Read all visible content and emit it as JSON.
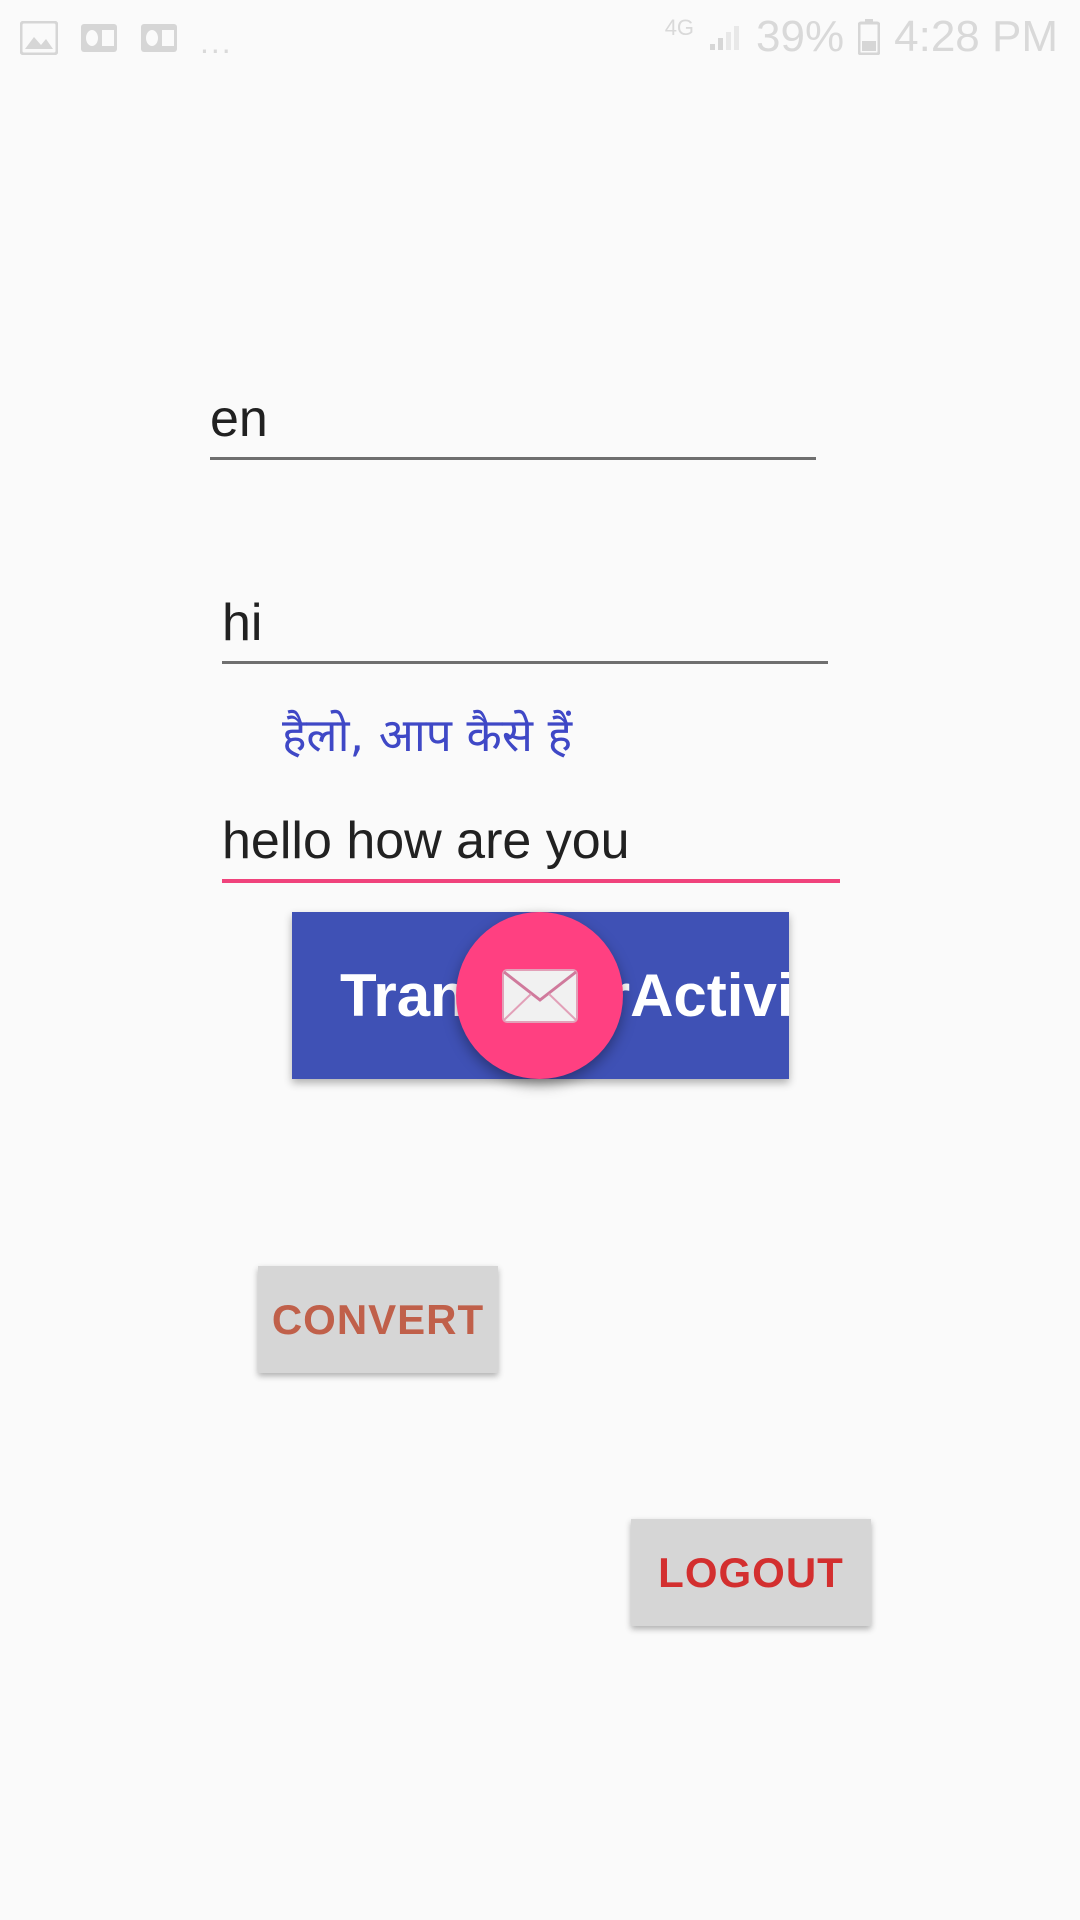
{
  "status_bar": {
    "left_icons": [
      "image-icon",
      "outlook-icon",
      "outlook-icon"
    ],
    "more": "...",
    "signal_text": "4G",
    "battery_percent": "39%",
    "time": "4:28 PM"
  },
  "form": {
    "source_language": "en",
    "target_language": "hi",
    "translated_text": "हैलो, आप कैसे हैं",
    "input_text": "hello how are you"
  },
  "buttons": {
    "activity_label": "TranslatorActivity",
    "convert_label": "CONVERT",
    "logout_label": "LOGOUT"
  },
  "fab": {
    "icon": "envelope-icon"
  },
  "colors": {
    "background": "#fafafa",
    "primary": "#3f51b5",
    "accent": "#ff4081",
    "translated_text": "#3f48c6",
    "convert_text": "#c0604a",
    "logout_text": "#d32f2f"
  }
}
